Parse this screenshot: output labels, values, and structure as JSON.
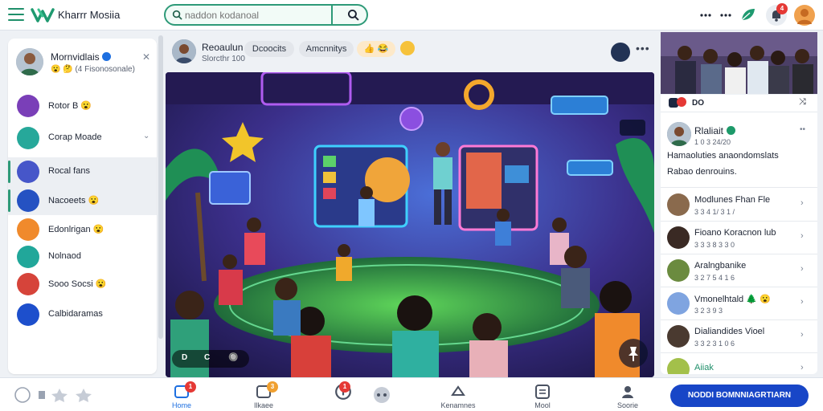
{
  "app": {
    "title": "Kharrr Mosiia",
    "search_placeholder": "naddon kodanoal",
    "notification_count": "4"
  },
  "sidebar": {
    "profile": {
      "name": "Mornvidlais",
      "sub": "😮 🤔 (4 Fisonosonale)"
    },
    "items": [
      {
        "label": "Rotor B 😮",
        "color": "#7a3fb8"
      },
      {
        "label": "Corap Moade",
        "color": "#26a89a"
      },
      {
        "label": "Rocal fans",
        "color": "#4656c9"
      },
      {
        "label": "Nacoeets 😮",
        "color": "#2552c2"
      },
      {
        "label": "Edonlrigan 😮",
        "color": "#f08a2c"
      },
      {
        "label": "Nolnaod",
        "color": "#21a79a"
      },
      {
        "label": "Sooo Socsi 😮",
        "color": "#d6443a"
      },
      {
        "label": "Calbidaramas",
        "color": "#1d4fcc"
      }
    ]
  },
  "post": {
    "author": "Reoaulun",
    "time": "Slorcthr 100",
    "chips": [
      "Dcoocits",
      "Amcnnitys",
      "👍 😂"
    ],
    "media_controls": [
      "D",
      "C",
      "🔘"
    ]
  },
  "right_panel": {
    "header_title": "DO",
    "feature": {
      "name": "Rlaliait",
      "time": "1 0 3 24/20",
      "line1": "Hamaoluties anaondomslats",
      "line2": "Rabao denrouins."
    },
    "friends": [
      {
        "name": "Modlunes Fhan Fle",
        "sub": "3 3 4 1/ 3 1 /",
        "color": "#8a6a4d"
      },
      {
        "name": "Fioano Koracnon lub",
        "sub": "3 3 3 8 3 3 0",
        "color": "#3a2a24"
      },
      {
        "name": "Aralngbanike",
        "sub": "3 2 7 5 4 1 6",
        "color": "#6b8b3f"
      },
      {
        "name": "Vmonelhtald 🌲 😮",
        "sub": "3 2 3 9 3",
        "color": "#7fa4e0"
      },
      {
        "name": "Dialiandides Vioel",
        "sub": "3 3 2 3 1 0 6",
        "color": "#4a3a30"
      },
      {
        "name": "Aiiak",
        "sub": "",
        "color": "#a3c04a"
      }
    ]
  },
  "bottom": {
    "tabs": [
      {
        "label": "Home",
        "badge": "1"
      },
      {
        "label": "Ilkaee",
        "badge": "3"
      },
      {
        "label": "",
        "badge": "1"
      },
      {
        "label": "Kenamnes",
        "badge": ""
      },
      {
        "label": "Mool",
        "badge": ""
      },
      {
        "label": "Soorie",
        "badge": ""
      }
    ],
    "cta_label": "NODDI BOMNNIAGRTIARN"
  }
}
